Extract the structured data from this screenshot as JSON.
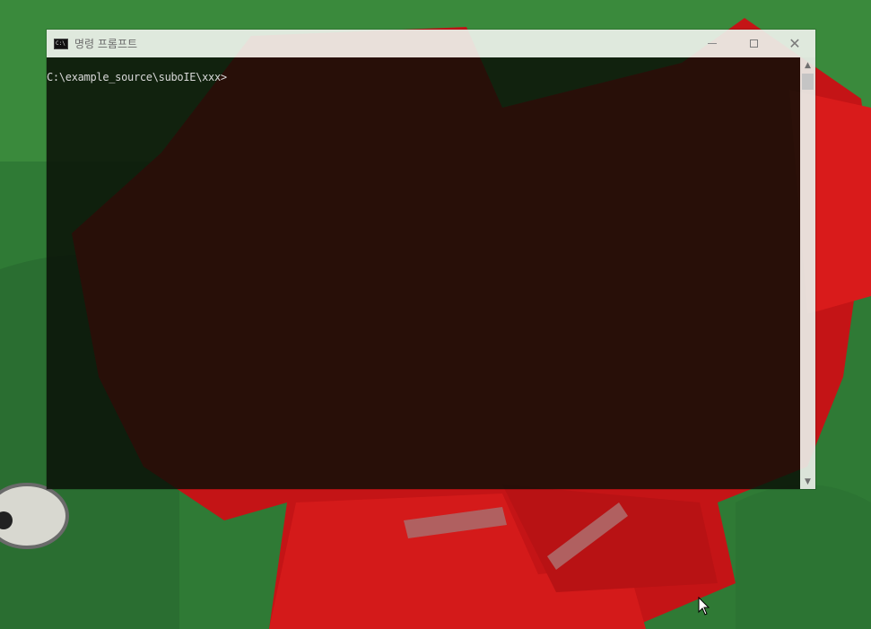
{
  "window": {
    "title": "명령 프롬프트",
    "app_icon": "C:\\",
    "controls": [
      "minimize-icon",
      "maximize-icon",
      "close-icon"
    ],
    "close_glyph": "✕"
  },
  "console": {
    "prompt": "C:\\example_source\\suboIE\\xxx>"
  },
  "scrollbar": {
    "up_arrow": "▲",
    "down_arrow": "▼"
  },
  "colors": {
    "wallpaper_green": "#2f7a35",
    "wallpaper_red": "#c41416",
    "console_bg": "#0a0e06",
    "console_text": "#d8d8d8",
    "titlebar_bg": "#ecf0ea"
  }
}
